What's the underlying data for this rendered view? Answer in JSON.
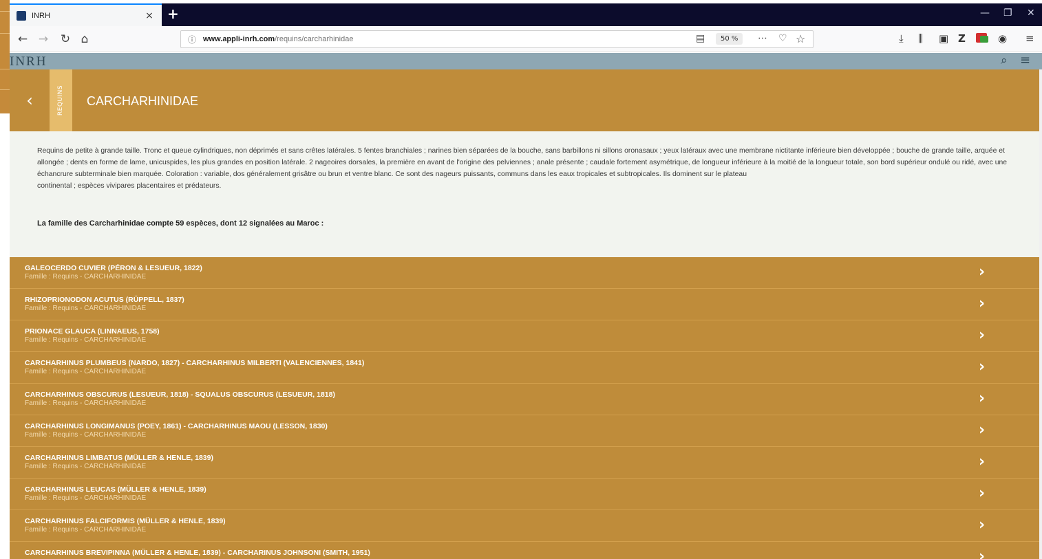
{
  "browser": {
    "tab_title": "INRH",
    "tab_close": "×",
    "new_tab": "+",
    "url_domain": "www.appli-inrh.com",
    "url_path": "/requins/carcharhinidae",
    "zoom": "50 %"
  },
  "site": {
    "logo": "INRH"
  },
  "page": {
    "back": "‹",
    "section_tab": "REQUINS",
    "title": "CARCHARHINIDAE",
    "description": "Requins de petite à grande taille. Tronc et queue cylindriques, non déprimés et sans crêtes latérales. 5 fentes branchiales ; narines bien séparées de la bouche, sans barbillons ni sillons oronasaux ; yeux latéraux avec une membrane nictitante inférieure bien développée ; bouche de grande taille, arquée et allongée ; dents en forme de lame, unicuspides, les plus grandes en position latérale. 2 nageoires dorsales, la première en avant de l'origine des pelviennes ; anale présente ; caudale fortement asymétrique, de longueur inférieure à la moitié de la longueur totale, son bord supérieur ondulé ou ridé, avec une échancrure subterminale bien marquée. Coloration : variable, dos généralement grisâtre ou brun et ventre blanc. Ce sont des nageurs puissants, communs dans les eaux tropicales et subtropicales. Ils dominent sur le plateau",
    "description_2": "continental ; espèces vivipares placentaires et prédateurs.",
    "count_text": "La famille des Carcharhinidae compte 59 espèces, dont 12 signalées au Maroc :"
  },
  "species": [
    {
      "name": "GALEOCERDO CUVIER (PÉRON & LESUEUR, 1822)",
      "family": "Famille : Requins - CARCHARHINIDAE"
    },
    {
      "name": "RHIZOPRIONODON ACUTUS (RÜPPELL, 1837)",
      "family": "Famille : Requins - CARCHARHINIDAE"
    },
    {
      "name": "PRIONACE GLAUCA (LINNAEUS, 1758)",
      "family": "Famille : Requins - CARCHARHINIDAE"
    },
    {
      "name": "CARCHARHINUS PLUMBEUS (NARDO, 1827) - CARCHARHINUS MILBERTI (VALENCIENNES, 1841)",
      "family": "Famille : Requins - CARCHARHINIDAE"
    },
    {
      "name": "CARCHARHINUS OBSCURUS (LESUEUR, 1818) - SQUALUS OBSCURUS (LESUEUR, 1818)",
      "family": "Famille : Requins - CARCHARHINIDAE"
    },
    {
      "name": "CARCHARHINUS LONGIMANUS (POEY, 1861) - CARCHARHINUS MAOU (LESSON, 1830)",
      "family": "Famille : Requins - CARCHARHINIDAE"
    },
    {
      "name": "CARCHARHINUS LIMBATUS (MÜLLER & HENLE, 1839)",
      "family": "Famille : Requins - CARCHARHINIDAE"
    },
    {
      "name": "CARCHARHINUS LEUCAS (MÜLLER & HENLE, 1839)",
      "family": "Famille : Requins - CARCHARHINIDAE"
    },
    {
      "name": "CARCHARHINUS FALCIFORMIS (MÜLLER & HENLE, 1839)",
      "family": "Famille : Requins - CARCHARHINIDAE"
    },
    {
      "name": "CARCHARHINUS BREVIPINNA (MÜLLER & HENLE, 1839) - CARCHARINUS JOHNSONI (SMITH, 1951)",
      "family": ""
    }
  ],
  "colors": {
    "accent": "#bf8c3a",
    "section_tab": "#e6bc6c",
    "header": "#8ea7b3",
    "description_bg": "#f2f4ef"
  }
}
